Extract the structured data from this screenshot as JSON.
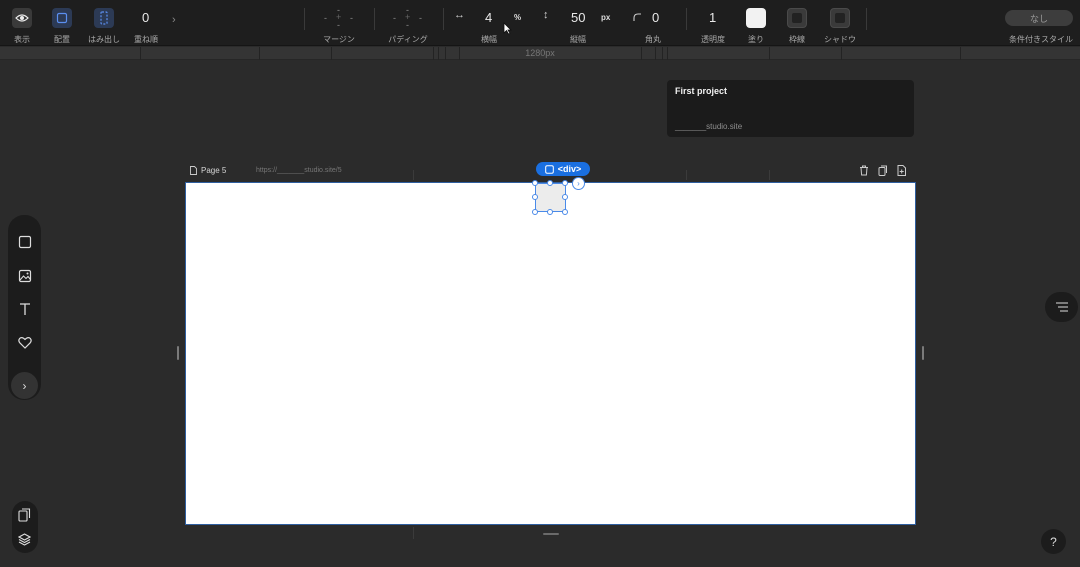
{
  "toolbar": {
    "view_label": "表示",
    "layout_label": "配置",
    "overflow_label": "はみ出し",
    "zindex_value": "0",
    "zindex_label": "重ね順",
    "margin_label": "マージン",
    "padding_label": "パディング",
    "width_value": "4",
    "width_unit": "%",
    "width_label": "横幅",
    "height_value": "50",
    "height_unit": "px",
    "height_label": "縦幅",
    "radius_value": "0",
    "radius_label": "角丸",
    "opacity_value": "1",
    "opacity_label": "透明度",
    "fill_label": "塗り",
    "border_label": "枠線",
    "shadow_label": "シャドウ",
    "conditional_value": "なし",
    "conditional_label": "条件付きスタイル"
  },
  "ruler": {
    "label": "1280px"
  },
  "project_card": {
    "title": "First project",
    "url": "_______studio.site"
  },
  "page": {
    "name": "Page 5",
    "url": "https://_______studio.site/5",
    "selected_tag": "<div>"
  },
  "colors": {
    "accent": "#1a6fe0",
    "canvas": "#ffffff",
    "fill_swatch": "#f2f2f2"
  }
}
